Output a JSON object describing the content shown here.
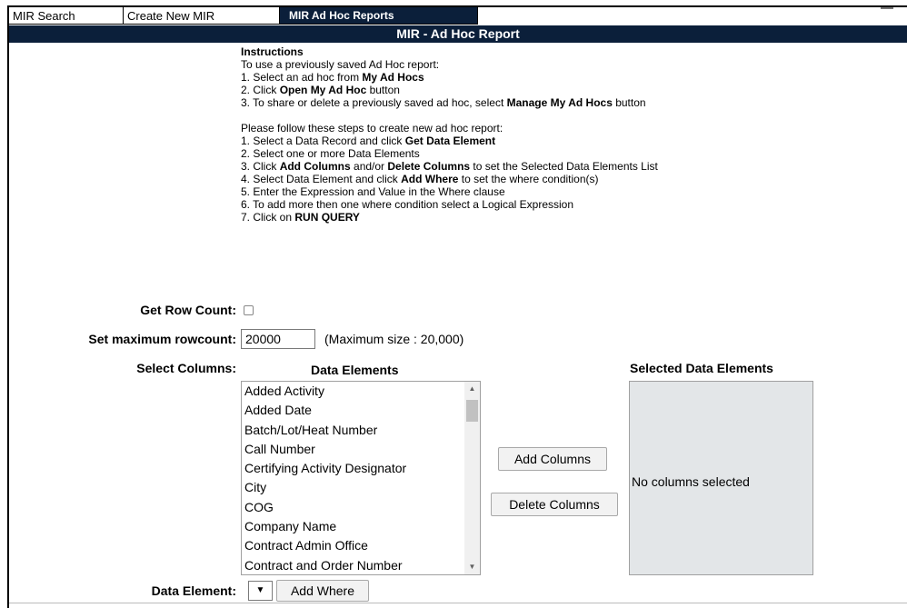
{
  "tabs": [
    {
      "label": "MIR Search"
    },
    {
      "label": "Create New MIR"
    },
    {
      "label": "MIR Ad Hoc Reports"
    }
  ],
  "title": "MIR - Ad Hoc Report",
  "instructions": {
    "heading": "Instructions",
    "intro": "To use a previously saved Ad Hoc report:",
    "s1": {
      "pre": "1. Select an ad hoc from ",
      "bold": "My Ad Hocs",
      "post": ""
    },
    "s2": {
      "pre": "2. Click ",
      "bold": "Open My Ad Hoc",
      "post": " button"
    },
    "s3": {
      "pre": "3. To share or delete a previously saved ad hoc, select ",
      "bold": "Manage My Ad Hocs",
      "post": " button"
    },
    "intro2": "Please follow these steps to create new ad hoc report:",
    "n1": {
      "pre": "1. Select a Data Record and click ",
      "bold": "Get Data Element"
    },
    "n2": "2. Select one or more Data Elements",
    "n3": {
      "pre": "3. Click ",
      "b1": "Add Columns",
      "mid": " and/or ",
      "b2": "Delete Columns",
      "post": " to set the Selected Data Elements List"
    },
    "n4": {
      "pre": "4. Select Data Element and click ",
      "bold": "Add Where",
      "post": " to set the where condition(s)"
    },
    "n5": "5. Enter the Expression and Value in the Where clause",
    "n6": "6. To add more then one where condition select a Logical Expression",
    "n7": {
      "pre": "7. Click on ",
      "bold": "RUN QUERY"
    }
  },
  "form": {
    "get_row_count_label": "Get Row Count:",
    "max_rowcount_label": "Set maximum rowcount:",
    "max_rowcount_value": "20000",
    "max_note": "(Maximum size : 20,000)",
    "select_columns_label": "Select Columns:",
    "data_elements_header": "Data Elements",
    "selected_header": "Selected Data Elements",
    "data_elements": [
      "Added Activity",
      "Added Date",
      "Batch/Lot/Heat Number",
      "Call Number",
      "Certifying Activity Designator",
      "City",
      "COG",
      "Company Name",
      "Contract Admin Office",
      "Contract and Order Number"
    ],
    "add_columns": "Add Columns",
    "delete_columns": "Delete Columns",
    "no_columns": "No columns selected",
    "data_element_label": "Data Element:",
    "add_where": "Add Where"
  },
  "icons": {
    "dropdown": "chevron-down-icon",
    "scroll_up": "scroll-up-icon",
    "scroll_down": "scroll-down-icon"
  },
  "colors": {
    "header_bg": "#0b1f3a",
    "selected_box_bg": "#e3e6e8"
  }
}
